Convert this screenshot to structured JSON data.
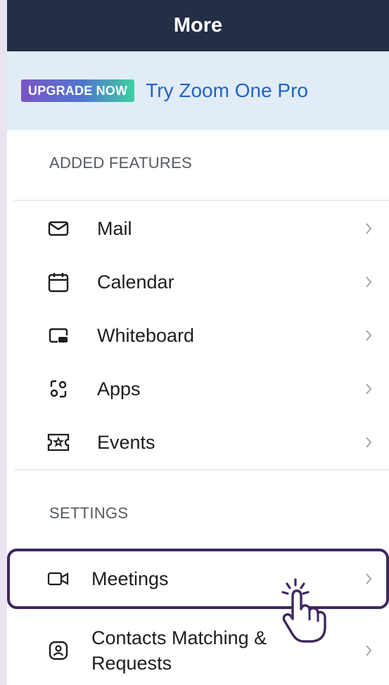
{
  "header": {
    "title": "More"
  },
  "promo": {
    "badge": "UPGRADE NOW",
    "link_text": "Try Zoom One Pro"
  },
  "sections": {
    "added_features": {
      "title": "ADDED FEATURES",
      "items": [
        {
          "label": "Mail",
          "icon": "mail-icon"
        },
        {
          "label": "Calendar",
          "icon": "calendar-icon"
        },
        {
          "label": "Whiteboard",
          "icon": "whiteboard-icon"
        },
        {
          "label": "Apps",
          "icon": "apps-icon"
        },
        {
          "label": "Events",
          "icon": "events-icon"
        }
      ]
    },
    "settings": {
      "title": "SETTINGS",
      "items": [
        {
          "label": "Meetings",
          "icon": "video-camera-icon"
        },
        {
          "label": "Contacts Matching & Requests",
          "icon": "contacts-icon"
        }
      ]
    }
  },
  "colors": {
    "header_bg": "#242e45",
    "banner_bg": "#e1ecf6",
    "link": "#1f63c9",
    "highlight_border": "#3f2760"
  }
}
